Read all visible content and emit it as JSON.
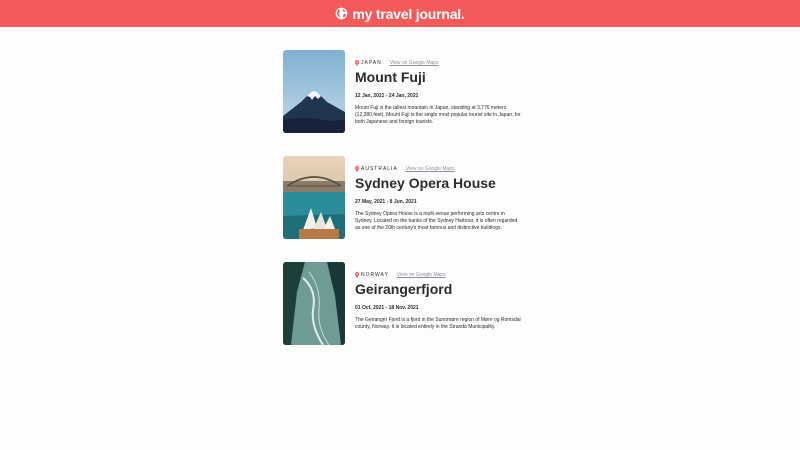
{
  "header": {
    "brand": "my travel journal.",
    "icon": "globe-icon",
    "background_color": "#f55a5a"
  },
  "entries": [
    {
      "country": "JAPAN",
      "map_link": "View on Google Maps",
      "title": "Mount Fuji",
      "dates": "12 Jan, 2021 - 24 Jan, 2021",
      "description": "Mount Fuji is the tallest mountain in Japan, standing at 3,776 meters (12,380 feet). Mount Fuji is the single most popular tourist site in Japan, for both Japanese and foreign tourists."
    },
    {
      "country": "AUSTRALIA",
      "map_link": "View on Google Maps",
      "title": "Sydney Opera House",
      "dates": "27 May, 2021 - 8 Jun, 2021",
      "description": "The Sydney Opera House is a multi-venue performing arts centre in Sydney. Located on the banks of the Sydney Harbour, it is often regarded as one of the 20th century's most famous and distinctive buildings."
    },
    {
      "country": "NORWAY",
      "map_link": "View on Google Maps",
      "title": "Geirangerfjord",
      "dates": "01 Oct, 2021 - 18 Nov, 2021",
      "description": "The Geiranger Fjord is a fjord in the Sunnmøre region of Møre og Romsdal county, Norway. It is located entirely in the Stranda Municipality."
    }
  ]
}
